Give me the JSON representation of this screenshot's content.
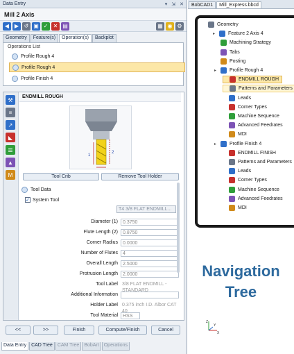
{
  "left_panel": {
    "title": "Data Entry",
    "title_controls": [
      "▾",
      "⇲",
      "✕"
    ],
    "header": "Mill 2 Axis",
    "tabs": [
      "Geometry",
      "Feature(s)",
      "Operation(s)",
      "Backplot"
    ],
    "active_tab": "Operation(s)",
    "operations_label": "Operations List",
    "operations": [
      {
        "label": "Profile Rough 4",
        "selected": false
      },
      {
        "label": "Profile Rough 4",
        "selected": true
      },
      {
        "label": "Profile Finish 4",
        "selected": false
      }
    ],
    "tool_name": "ENDMILL ROUGH",
    "tool_diagram_dims": {
      "d1": "1",
      "d2": "2"
    },
    "buttons": {
      "tool_crib": "Tool Crib",
      "remove_holder": "Remove Tool Holder"
    },
    "tool_data_label": "Tool Data",
    "system_tool_label": "System Tool",
    "system_tool_checked": true,
    "tool_select_value": "T4 3/8 FLAT ENDMILL...",
    "fields": [
      {
        "label": "Diameter (1)",
        "value": "0.3750",
        "kind": "wide"
      },
      {
        "label": "Flute Length (2)",
        "value": "0.8750",
        "kind": "wide"
      },
      {
        "label": "Corner Radius",
        "value": "0.0000",
        "kind": "wide"
      },
      {
        "label": "Number of Flutes",
        "value": "4",
        "kind": "wide"
      },
      {
        "label": "Overall Length",
        "value": "2.5000",
        "kind": "wide"
      },
      {
        "label": "Protrusion Length",
        "value": "2.0000",
        "kind": "wide"
      },
      {
        "label": "Tool Label",
        "value": "3/8 FLAT ENDMILL - STANDARD",
        "kind": "txt"
      },
      {
        "label": "Additional Information",
        "value": "",
        "kind": "wide"
      },
      {
        "label": "Holder Label",
        "value": "0.375 inch I.D. Albor CAT 40",
        "kind": "txt"
      },
      {
        "label": "Tool Material",
        "value": "HSS",
        "kind": "nar"
      }
    ],
    "nav_buttons": [
      "<<",
      ">>",
      "Finish",
      "Compute/Finish",
      "Cancel"
    ],
    "bottom_tabs": [
      "Data Entry",
      "CAD Tree",
      "CAM Tree",
      "BobArt",
      "Operations"
    ],
    "active_bottom_tab": "Data Entry"
  },
  "right_panel": {
    "tabs": [
      "BobCAD1",
      "Mill_Express.bbcd"
    ],
    "active_tab": "Mill_Express.bbcd",
    "tree": [
      {
        "label": "Geometry",
        "level": 0,
        "icon": "geometry-icon",
        "expander": "",
        "state": ""
      },
      {
        "label": "Feature 2 Axis 4",
        "level": 1,
        "icon": "feature-icon",
        "expander": "▸",
        "state": ""
      },
      {
        "label": "Machining Strategy",
        "level": 2,
        "icon": "strategy-icon",
        "expander": "",
        "state": ""
      },
      {
        "label": "Tabs",
        "level": 2,
        "icon": "tabs-icon",
        "expander": "",
        "state": ""
      },
      {
        "label": "Posting",
        "level": 2,
        "icon": "posting-icon",
        "expander": "",
        "state": ""
      },
      {
        "label": "Profile Rough 4",
        "level": 2,
        "icon": "operation-icon",
        "expander": "▸",
        "state": ""
      },
      {
        "label": "ENDMILL ROUGH",
        "level": 3,
        "icon": "tool-icon",
        "expander": "",
        "state": "sel"
      },
      {
        "label": "Patterns and Parameters",
        "level": 3,
        "icon": "parameters-icon",
        "expander": "",
        "state": "hov"
      },
      {
        "label": "Leads",
        "level": 3,
        "icon": "leads-icon",
        "expander": "",
        "state": ""
      },
      {
        "label": "Corner Types",
        "level": 3,
        "icon": "corner-icon",
        "expander": "",
        "state": ""
      },
      {
        "label": "Machine Sequence",
        "level": 3,
        "icon": "sequence-icon",
        "expander": "",
        "state": ""
      },
      {
        "label": "Advanced Feedrates",
        "level": 3,
        "icon": "feedrate-icon",
        "expander": "",
        "state": ""
      },
      {
        "label": "MDI",
        "level": 3,
        "icon": "mdi-icon",
        "expander": "",
        "state": ""
      },
      {
        "label": "Profile Finish 4",
        "level": 2,
        "icon": "operation-icon",
        "expander": "▸",
        "state": ""
      },
      {
        "label": "ENDMILL FINISH",
        "level": 3,
        "icon": "tool-icon",
        "expander": "",
        "state": ""
      },
      {
        "label": "Patterns and Parameters",
        "level": 3,
        "icon": "parameters-icon",
        "expander": "",
        "state": ""
      },
      {
        "label": "Leads",
        "level": 3,
        "icon": "leads-icon",
        "expander": "",
        "state": ""
      },
      {
        "label": "Corner Types",
        "level": 3,
        "icon": "corner-icon",
        "expander": "",
        "state": ""
      },
      {
        "label": "Machine Sequence",
        "level": 3,
        "icon": "sequence-icon",
        "expander": "",
        "state": ""
      },
      {
        "label": "Advanced Feedrates",
        "level": 3,
        "icon": "feedrate-icon",
        "expander": "",
        "state": ""
      },
      {
        "label": "MDI",
        "level": 3,
        "icon": "mdi-icon",
        "expander": "",
        "state": ""
      }
    ],
    "nav_label_line1": "Navigation",
    "nav_label_line2": "Tree",
    "axes_labels": {
      "z": "Z",
      "y": "Y",
      "x": "X"
    }
  },
  "colors": {
    "accent_blue": "#2e6a9e",
    "selection": "#fde9a9",
    "highlight_border": "#1a1a1a"
  }
}
